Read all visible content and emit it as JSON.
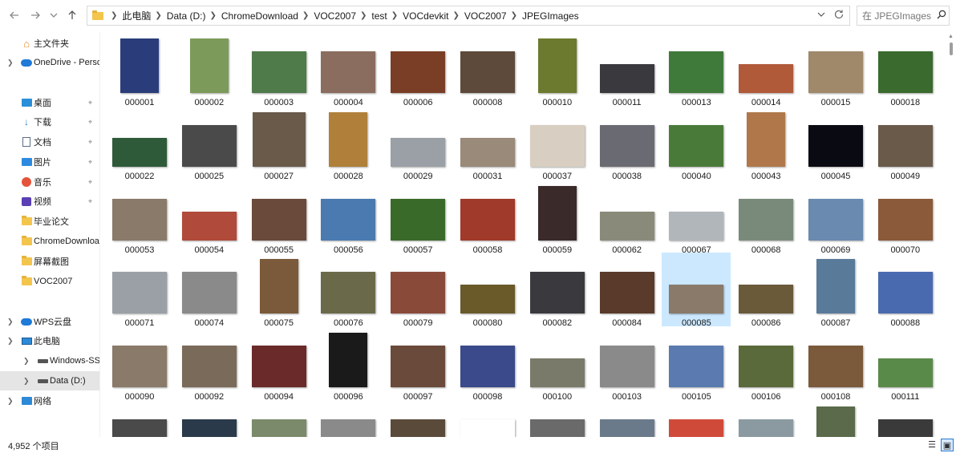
{
  "window": {
    "breadcrumb": [
      "此电脑",
      "Data (D:)",
      "ChromeDownload",
      "VOC2007",
      "test",
      "VOCdevkit",
      "VOC2007",
      "JPEGImages"
    ],
    "search_placeholder": "在 JPEGImages ..."
  },
  "sidebar": {
    "items": [
      {
        "label": "主文件夹",
        "icon": "home-icon",
        "chevron": false,
        "pinned": false
      },
      {
        "label": "OneDrive - Persor",
        "icon": "onedrive-cloud-icon",
        "chevron": true,
        "pinned": false
      },
      {
        "label": "桌面",
        "icon": "desktop-icon",
        "chevron": false,
        "pinned": true
      },
      {
        "label": "下载",
        "icon": "download-icon",
        "chevron": false,
        "pinned": true
      },
      {
        "label": "文档",
        "icon": "document-icon",
        "chevron": false,
        "pinned": true
      },
      {
        "label": "图片",
        "icon": "pictures-icon",
        "chevron": false,
        "pinned": true
      },
      {
        "label": "音乐",
        "icon": "music-icon",
        "chevron": false,
        "pinned": true
      },
      {
        "label": "视频",
        "icon": "video-icon",
        "chevron": false,
        "pinned": true
      },
      {
        "label": "毕业论文",
        "icon": "folder-icon",
        "chevron": false,
        "pinned": false
      },
      {
        "label": "ChromeDownloac",
        "icon": "folder-icon",
        "chevron": false,
        "pinned": false
      },
      {
        "label": "屏幕截图",
        "icon": "folder-icon",
        "chevron": false,
        "pinned": false
      },
      {
        "label": "VOC2007",
        "icon": "folder-icon",
        "chevron": false,
        "pinned": false
      },
      {
        "label": "WPS云盘",
        "icon": "wps-cloud-icon",
        "chevron": true,
        "pinned": false
      },
      {
        "label": "此电脑",
        "icon": "this-pc-icon",
        "chevron": true,
        "pinned": false
      },
      {
        "label": "Windows-SSD (C",
        "icon": "drive-icon",
        "chevron": true,
        "pinned": false
      },
      {
        "label": "Data (D:)",
        "icon": "drive-icon",
        "chevron": true,
        "pinned": false,
        "selected": true
      },
      {
        "label": "网络",
        "icon": "network-icon",
        "chevron": true,
        "pinned": false
      }
    ]
  },
  "files": [
    {
      "name": "000001",
      "color": "#2a3d7a",
      "orient": "p"
    },
    {
      "name": "000002",
      "color": "#7c9a5a",
      "orient": "p"
    },
    {
      "name": "000003",
      "color": "#4f7a4a",
      "orient": "l"
    },
    {
      "name": "000004",
      "color": "#8a6d5e",
      "orient": "l"
    },
    {
      "name": "000006",
      "color": "#7a3e26",
      "orient": "l"
    },
    {
      "name": "000008",
      "color": "#5e4a3a",
      "orient": "l"
    },
    {
      "name": "000010",
      "color": "#6b7a2e",
      "orient": "p"
    },
    {
      "name": "000011",
      "color": "#3a3a3e",
      "orient": "w"
    },
    {
      "name": "000013",
      "color": "#3f7a3a",
      "orient": "l"
    },
    {
      "name": "000014",
      "color": "#b05a3a",
      "orient": "w"
    },
    {
      "name": "000015",
      "color": "#a0886a",
      "orient": "l"
    },
    {
      "name": "000018",
      "color": "#3a6a2e",
      "orient": "l"
    },
    {
      "name": "000022",
      "color": "#2e5a3a",
      "orient": "w"
    },
    {
      "name": "000025",
      "color": "#4a4a4a",
      "orient": "l"
    },
    {
      "name": "000027",
      "color": "#6a5a4a",
      "orient": "q"
    },
    {
      "name": "000028",
      "color": "#b0803a",
      "orient": "p"
    },
    {
      "name": "000029",
      "color": "#9aa0a6",
      "orient": "w"
    },
    {
      "name": "000031",
      "color": "#9a8a7a",
      "orient": "w"
    },
    {
      "name": "000037",
      "color": "#d8cfc2",
      "orient": "l"
    },
    {
      "name": "000038",
      "color": "#6a6a72",
      "orient": "l"
    },
    {
      "name": "000040",
      "color": "#4a7a3a",
      "orient": "l"
    },
    {
      "name": "000043",
      "color": "#b0784a",
      "orient": "p"
    },
    {
      "name": "000045",
      "color": "#0a0a12",
      "orient": "l"
    },
    {
      "name": "000049",
      "color": "#6a5a4a",
      "orient": "l"
    },
    {
      "name": "000053",
      "color": "#8a7a6a",
      "orient": "l"
    },
    {
      "name": "000054",
      "color": "#b04a3a",
      "orient": "w"
    },
    {
      "name": "000055",
      "color": "#6a4a3a",
      "orient": "l"
    },
    {
      "name": "000056",
      "color": "#4a7ab0",
      "orient": "l"
    },
    {
      "name": "000057",
      "color": "#3a6a2a",
      "orient": "l"
    },
    {
      "name": "000058",
      "color": "#a03a2a",
      "orient": "l"
    },
    {
      "name": "000059",
      "color": "#3a2a2a",
      "orient": "p"
    },
    {
      "name": "000062",
      "color": "#8a8a7a",
      "orient": "w"
    },
    {
      "name": "000067",
      "color": "#b0b6ba",
      "orient": "w"
    },
    {
      "name": "000068",
      "color": "#7a8a7a",
      "orient": "l"
    },
    {
      "name": "000069",
      "color": "#6a8ab0",
      "orient": "l"
    },
    {
      "name": "000070",
      "color": "#8a5a3a",
      "orient": "l"
    },
    {
      "name": "000071",
      "color": "#9aa0a6",
      "orient": "l"
    },
    {
      "name": "000074",
      "color": "#8a8a8a",
      "orient": "l"
    },
    {
      "name": "000075",
      "color": "#7a5a3a",
      "orient": "p"
    },
    {
      "name": "000076",
      "color": "#6a6a4a",
      "orient": "l"
    },
    {
      "name": "000079",
      "color": "#8a4a3a",
      "orient": "l"
    },
    {
      "name": "000080",
      "color": "#6a5a2a",
      "orient": "w"
    },
    {
      "name": "000082",
      "color": "#3a3a3e",
      "orient": "l"
    },
    {
      "name": "000084",
      "color": "#5a3a2a",
      "orient": "l"
    },
    {
      "name": "000085",
      "color": "#8a7a6a",
      "orient": "w",
      "selected": true
    },
    {
      "name": "000086",
      "color": "#6a5a3a",
      "orient": "w"
    },
    {
      "name": "000087",
      "color": "#5a7a9a",
      "orient": "p"
    },
    {
      "name": "000088",
      "color": "#4a6ab0",
      "orient": "l"
    },
    {
      "name": "000090",
      "color": "#8a7a6a",
      "orient": "l"
    },
    {
      "name": "000092",
      "color": "#7a6a5a",
      "orient": "l"
    },
    {
      "name": "000094",
      "color": "#6a2a2a",
      "orient": "l"
    },
    {
      "name": "000096",
      "color": "#1a1a1a",
      "orient": "p"
    },
    {
      "name": "000097",
      "color": "#6a4a3a",
      "orient": "l"
    },
    {
      "name": "000098",
      "color": "#3a4a8a",
      "orient": "l"
    },
    {
      "name": "000100",
      "color": "#7a7a6a",
      "orient": "w"
    },
    {
      "name": "000103",
      "color": "#8a8a8a",
      "orient": "l"
    },
    {
      "name": "000105",
      "color": "#5a7ab0",
      "orient": "l"
    },
    {
      "name": "000106",
      "color": "#5a6a3a",
      "orient": "l"
    },
    {
      "name": "000108",
      "color": "#7a5a3a",
      "orient": "l"
    },
    {
      "name": "000111",
      "color": "#5a8a4a",
      "orient": "w"
    },
    {
      "name": "",
      "color": "#4a4a4a",
      "orient": "l"
    },
    {
      "name": "",
      "color": "#2a3a4a",
      "orient": "l"
    },
    {
      "name": "",
      "color": "#7a8a6a",
      "orient": "l"
    },
    {
      "name": "",
      "color": "#8a8a8a",
      "orient": "l"
    },
    {
      "name": "",
      "color": "#5a4a3a",
      "orient": "l"
    },
    {
      "name": "",
      "color": "#ffffff",
      "orient": "l"
    },
    {
      "name": "",
      "color": "#6a6a6a",
      "orient": "l"
    },
    {
      "name": "",
      "color": "#6a7a8a",
      "orient": "l"
    },
    {
      "name": "",
      "color": "#d04a3a",
      "orient": "l"
    },
    {
      "name": "",
      "color": "#8a9aa0",
      "orient": "l"
    },
    {
      "name": "",
      "color": "#5a6a4a",
      "orient": "p"
    },
    {
      "name": "",
      "color": "#3a3a3a",
      "orient": "l"
    }
  ],
  "status": {
    "item_count": "4,952 个项目"
  },
  "accent": "#cce8ff"
}
